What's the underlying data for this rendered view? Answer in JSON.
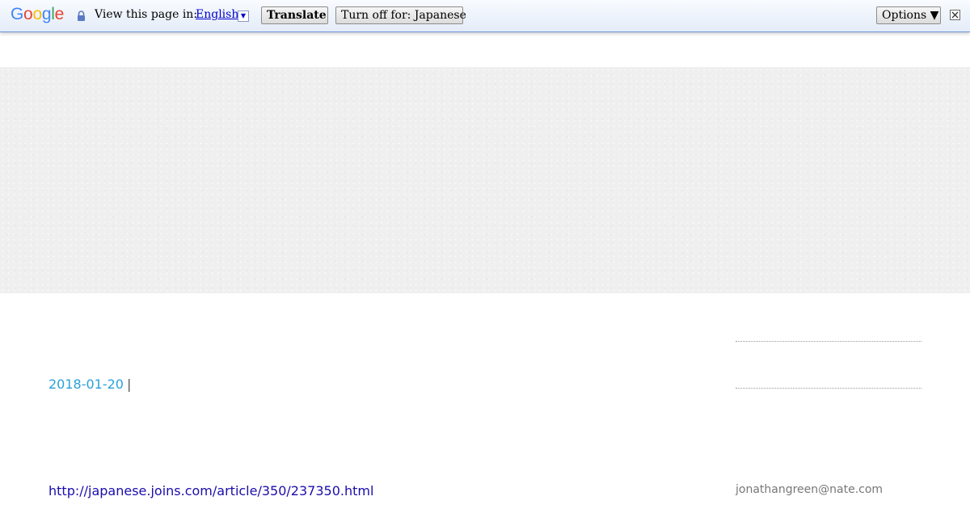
{
  "translate_bar": {
    "logo_letters": [
      {
        "char": "G",
        "color": "#4285f4"
      },
      {
        "char": "o",
        "color": "#ea4335"
      },
      {
        "char": "o",
        "color": "#fbbc05"
      },
      {
        "char": "g",
        "color": "#4285f4"
      },
      {
        "char": "l",
        "color": "#34a853"
      },
      {
        "char": "e",
        "color": "#ea4335"
      }
    ],
    "lock_icon": "lock-icon",
    "view_label": "View this page in:",
    "language": "English",
    "language_dropdown_glyph": "▼",
    "translate_button": "Translate",
    "turn_off_button": "Turn off for: Japanese",
    "options_button": "Options ▼",
    "close_icon": "close-icon",
    "accent_border": "#6b90da"
  },
  "main": {
    "post_date": "2018-01-20",
    "separator": "|",
    "source_url": "http://japanese.joins.com/article/350/237350.html"
  },
  "sidebar": {
    "email": "jonathangreen@nate.com"
  },
  "colors": {
    "date_link": "#2aa1d8",
    "source_link": "#1a0dab",
    "email_text": "#777777",
    "banner_bg": "#efefef"
  }
}
